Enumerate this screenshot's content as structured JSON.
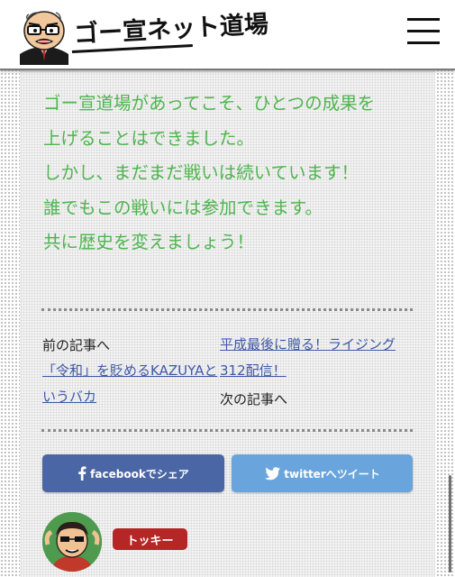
{
  "header": {
    "site_title": "ゴー宣ネット道場",
    "logo_icon": "mascot-logo-icon",
    "menu_icon": "hamburger-menu-icon"
  },
  "article": {
    "closing_lines": [
      "ゴー宣道場があってこそ、ひとつの成果を",
      "上げることはできました。",
      "しかし、まだまだ戦いは続いています！",
      "誰でもこの戦いには参加できます。",
      "共に歴史を変えましょう！"
    ]
  },
  "navigation": {
    "prev_label": "前の記事へ",
    "prev_title": "「令和」を貶めるKAZUYAというバカ",
    "next_label": "次の記事へ",
    "next_title": "平成最後に贈る！ライジング312配信！"
  },
  "share": {
    "facebook_label": "facebookでシェア",
    "twitter_label": "twitterへツイート"
  },
  "author": {
    "name": "トッキー"
  },
  "colors": {
    "accent_green": "#4fb54f",
    "link_blue": "#3f58a8",
    "facebook_blue": "#4a66a4",
    "twitter_blue": "#69a5dc",
    "author_badge_red": "#b52626"
  }
}
